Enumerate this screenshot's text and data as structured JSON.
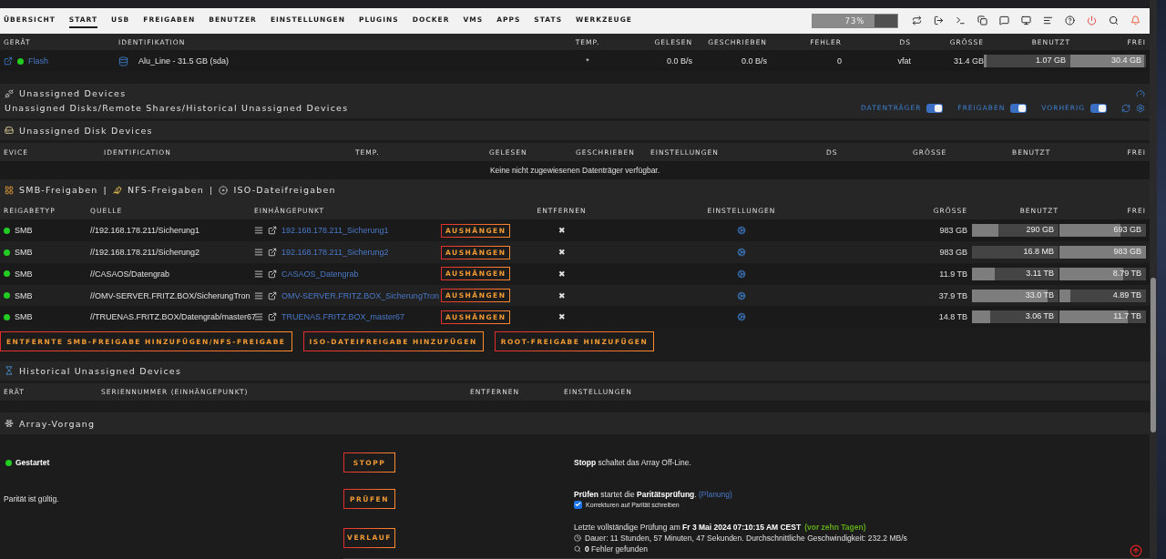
{
  "nav": {
    "tabs": [
      {
        "label": "ÜBERSICHT",
        "selected": false
      },
      {
        "label": "START",
        "selected": true
      },
      {
        "label": "USB",
        "selected": false
      },
      {
        "label": "FREIGABEN",
        "selected": false
      },
      {
        "label": "BENUTZER",
        "selected": false
      },
      {
        "label": "EINSTELLUNGEN",
        "selected": false
      },
      {
        "label": "PLUGINS",
        "selected": false
      },
      {
        "label": "DOCKER",
        "selected": false
      },
      {
        "label": "VMS",
        "selected": false
      },
      {
        "label": "APPS",
        "selected": false
      },
      {
        "label": "STATS",
        "selected": false
      },
      {
        "label": "WERKZEUGE",
        "selected": false
      }
    ],
    "usage": {
      "label": "73%",
      "level": 0.73
    }
  },
  "boot_table": {
    "columns": [
      "GERÄT",
      "IDENTIFIKATION",
      "TEMP.",
      "GELESEN",
      "GESCHRIEBEN",
      "FEHLER",
      "DS",
      "GRÖSSE",
      "BENUTZT",
      "FREI"
    ],
    "rows": [
      {
        "device": "Flash",
        "online": true,
        "identification": "Alu_Line - 31.5 GB (sda)",
        "temp": "*",
        "read": "0.0 B/s",
        "written": "0.0 B/s",
        "errors": "0",
        "fs": "vfat",
        "size": "31.4 GB",
        "used": {
          "text": "1.07 GB",
          "level": 0.03
        },
        "free": {
          "text": "30.4 GB",
          "level": 0.97
        }
      }
    ]
  },
  "unassigned": {
    "title": "Unassigned Devices",
    "subtitle": "Unassigned Disks/Remote Shares/Historical Unassigned Devices",
    "toggles": [
      {
        "label": "DATENTRÄGER",
        "on": true
      },
      {
        "label": "FREIGABEN",
        "on": true
      },
      {
        "label": "VORHERIG",
        "on": true
      }
    ],
    "disk_devices": {
      "title": "Unassigned Disk Devices",
      "columns": [
        "EVICE",
        "IDENTIFICATION",
        "TEMP.",
        "GELESEN",
        "GESCHRIEBEN",
        "EINSTELLUNGEN",
        "DS",
        "GRÖSSE",
        "BENUTZT",
        "FREI"
      ],
      "empty_text": "Keine nicht zugewiesenen Datenträger verfügbar."
    },
    "shares": {
      "titles": [
        "SMB-Freigaben",
        "NFS-Freigaben",
        "ISO-Dateifreigaben"
      ],
      "separator": "|",
      "columns": [
        "REIGABETYP",
        "QUELLE",
        "EINHÄNGEPUNKT",
        "ENTFERNEN",
        "EINSTELLUNGEN",
        "GRÖSSE",
        "BENUTZT",
        "FREI"
      ],
      "rows": [
        {
          "online": true,
          "type": "SMB",
          "source": "//192.168.178.211/Sicherung1",
          "mountpoint": "192.168.178.211_Sicherung1",
          "action": "AUSHÄNGEN",
          "remove": "✖",
          "size": "983 GB",
          "used": {
            "text": "290 GB",
            "level": 0.3
          },
          "free": {
            "text": "693 GB",
            "level": 0.7
          }
        },
        {
          "online": true,
          "type": "SMB",
          "source": "//192.168.178.211/Sicherung2",
          "mountpoint": "192.168.178.211_Sicherung2",
          "action": "AUSHÄNGEN",
          "remove": "✖",
          "size": "983 GB",
          "used": {
            "text": "16.8 MB",
            "level": 0
          },
          "free": {
            "text": "983 GB",
            "level": 1
          }
        },
        {
          "online": true,
          "type": "SMB",
          "source": "//CASAOS/Datengrab",
          "mountpoint": "CASAOS_Datengrab",
          "action": "AUSHÄNGEN",
          "remove": "✖",
          "size": "11.9 TB",
          "used": {
            "text": "3.11 TB",
            "level": 0.26
          },
          "free": {
            "text": "8.79 TB",
            "level": 0.74
          }
        },
        {
          "online": true,
          "type": "SMB",
          "source": "//OMV-SERVER.FRITZ.BOX/SicherungTron",
          "mountpoint": "OMV-SERVER.FRITZ.BOX_SicherungTron",
          "action": "AUSHÄNGEN",
          "remove": "✖",
          "size": "37.9 TB",
          "used": {
            "text": "33.0 TB",
            "level": 0.87
          },
          "free": {
            "text": "4.89 TB",
            "level": 0.13
          }
        },
        {
          "online": true,
          "type": "SMB",
          "source": "//TRUENAS.FRITZ.BOX/Datengrab/master67",
          "mountpoint": "TRUENAS.FRITZ.BOX_master67",
          "action": "AUSHÄNGEN",
          "remove": "✖",
          "size": "14.8 TB",
          "used": {
            "text": "3.06 TB",
            "level": 0.21
          },
          "free": {
            "text": "11.7 TB",
            "level": 0.79
          }
        }
      ],
      "add_buttons": [
        "ENTFERNTE SMB-FREIGABE HINZUFÜGEN/NFS-FREIGABE",
        "ISO-DATEIFREIGABE HINZUFÜGEN",
        "ROOT-FREIGABE HINZUFÜGEN"
      ]
    },
    "historical": {
      "title": "Historical Unassigned Devices",
      "columns": [
        "ERÄT",
        "SERIENNUMMER (EINHÄNGEPUNKT)",
        "ENTFERNEN",
        "EINSTELLUNGEN"
      ]
    }
  },
  "array": {
    "title": "Array-Vorgang",
    "status": {
      "label": "Gestartet",
      "started": true
    },
    "parity": "Parität ist gültig.",
    "actions": [
      {
        "button": "STOPP",
        "description": "**Stopp** schaltet das Array Off-Line."
      },
      {
        "button": "PRÜFEN",
        "description": "**Prüfen** startet die **Paritätsprüfung**.",
        "link": "(Planung)",
        "option": {
          "label": "Korrekturen auf Parität schreiben",
          "checked": true
        }
      },
      {
        "button": "VERLAUF",
        "history": {
          "last_check": "Letzte vollständige Prüfung am **Fr 3 Mai 2024 07:10:15 AM CEST**",
          "age": "(vor zehn Tagen)",
          "duration": "Dauer: 11 Stunden, 57 Minuten, 47 Sekunden. Durchschnittliche Geschwindigkeit: 232.2 MB/s",
          "errors": "**0** Fehler gefunden"
        }
      }
    ]
  }
}
